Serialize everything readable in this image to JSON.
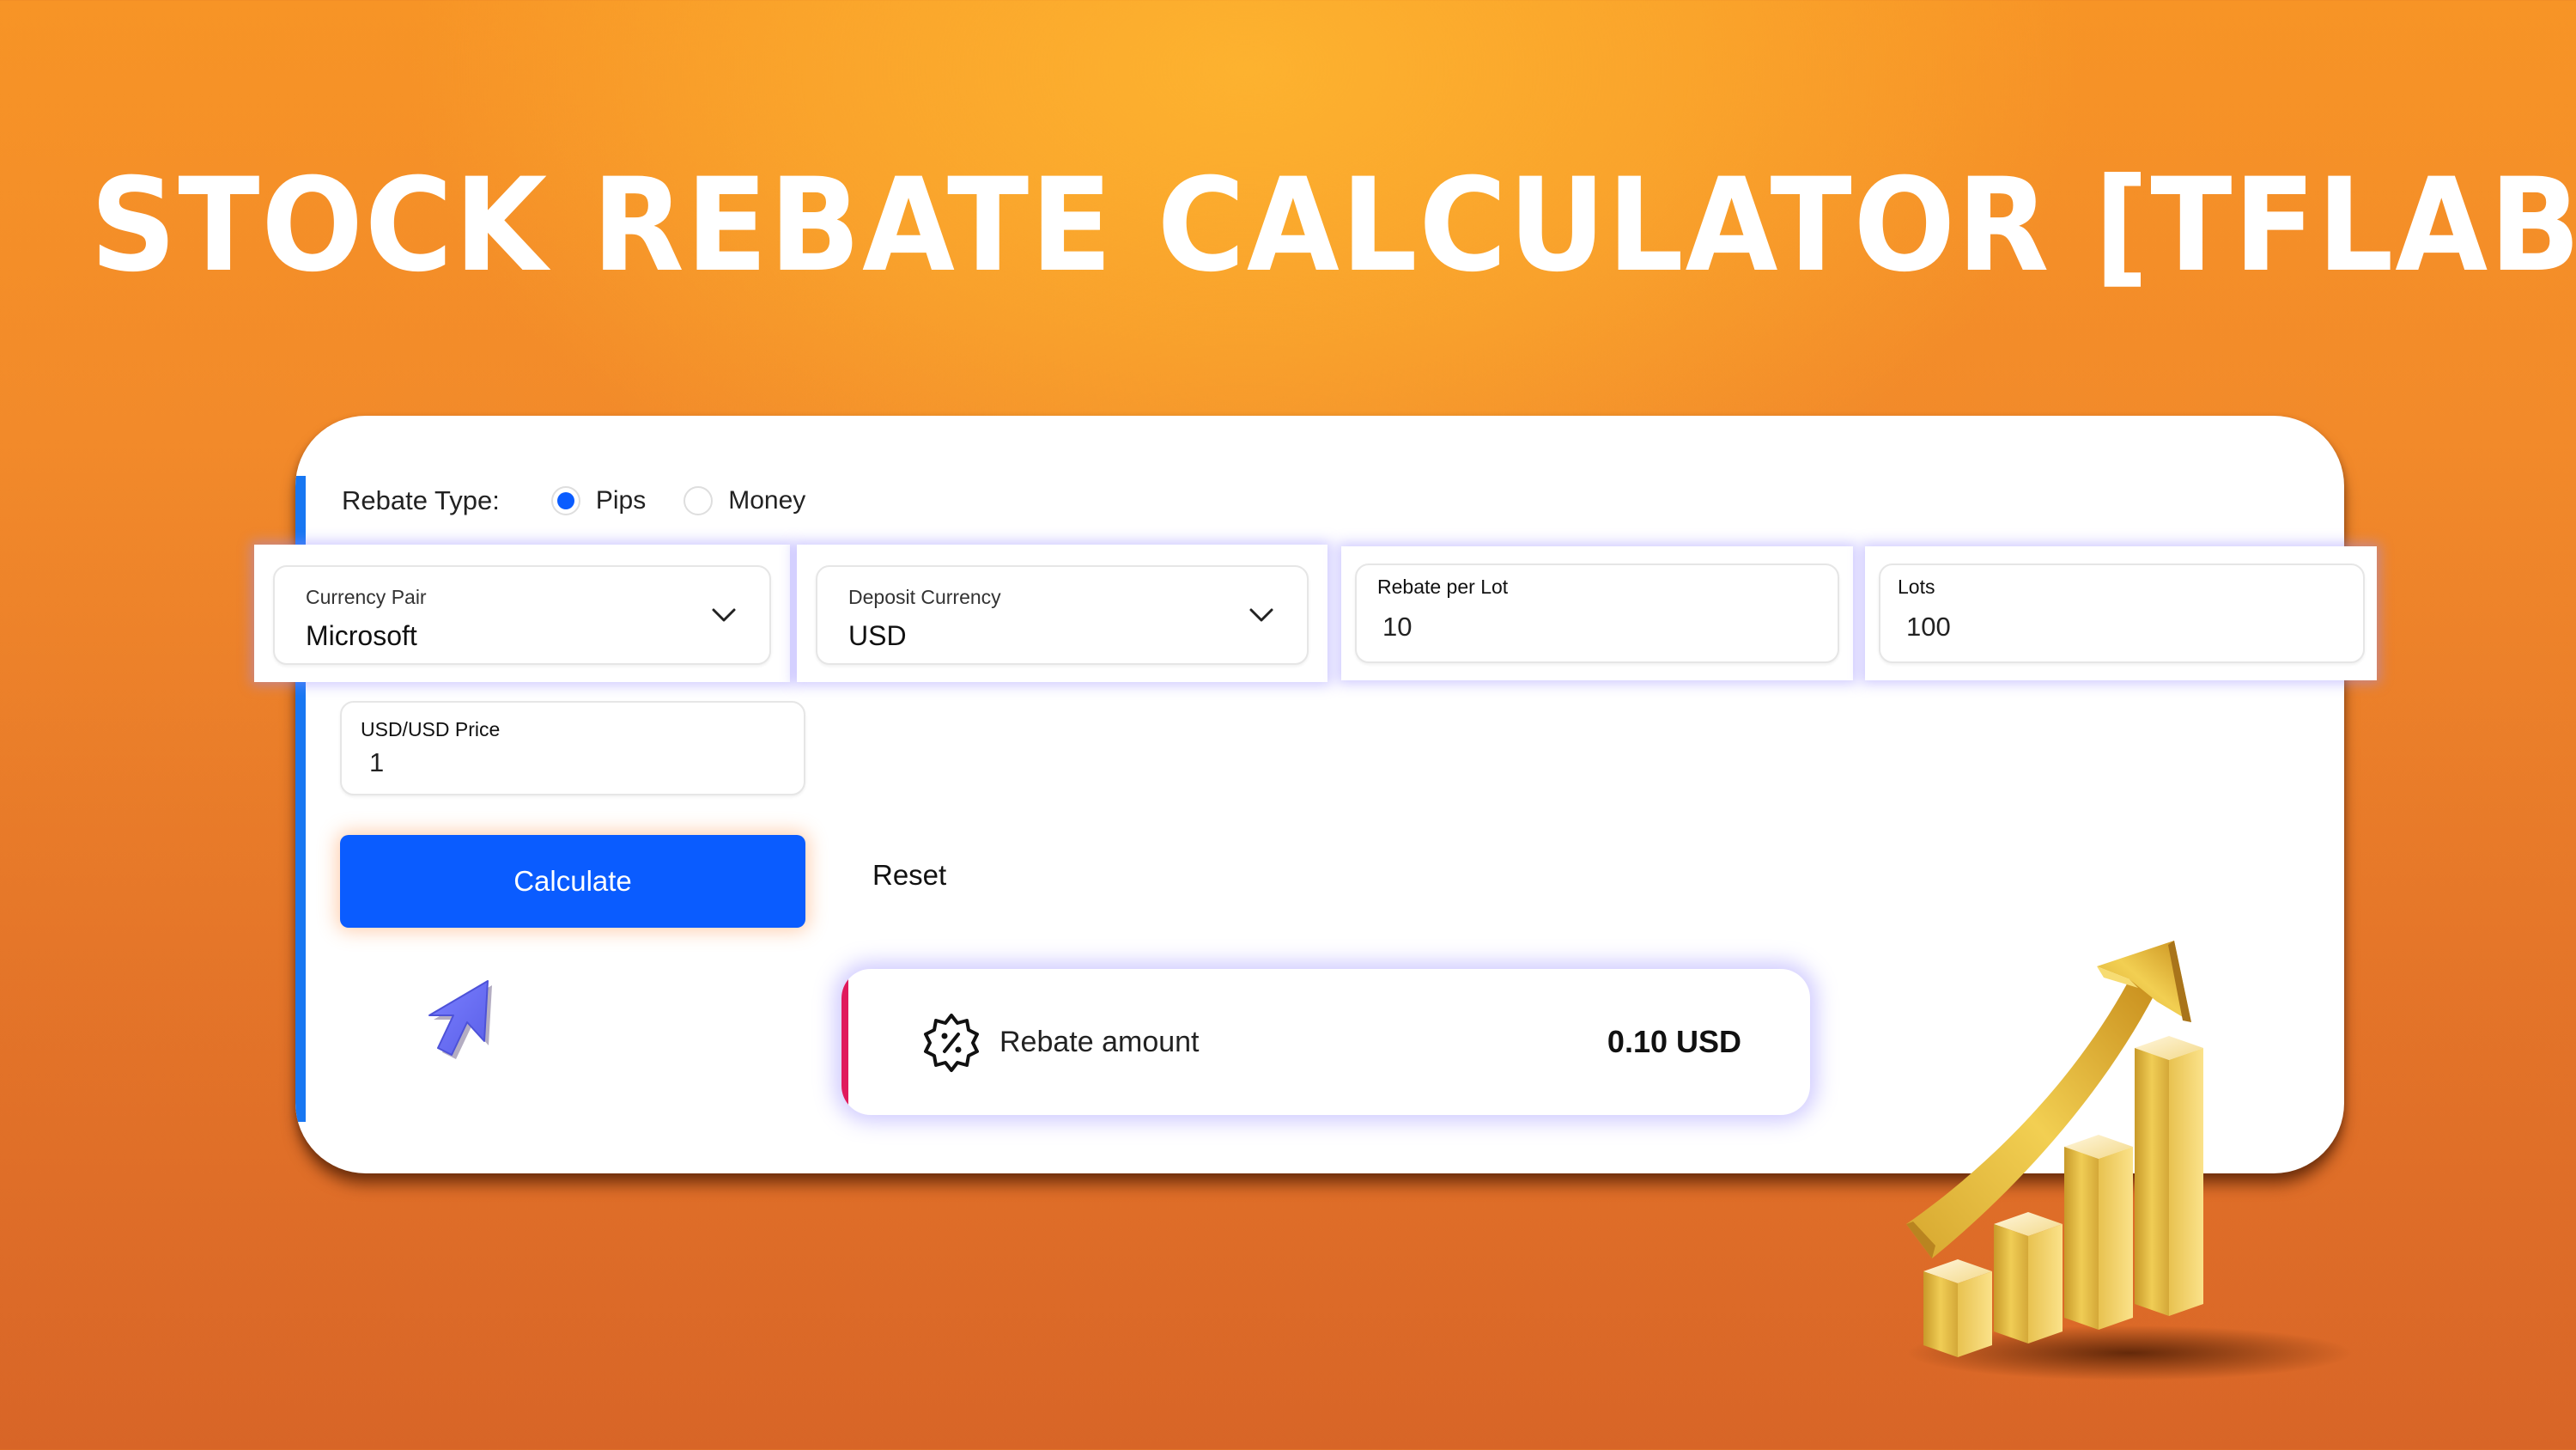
{
  "title": "STOCK REBATE CALCULATOR [TFLAB]",
  "rebate_type": {
    "label": "Rebate Type:",
    "options": [
      {
        "label": "Pips",
        "selected": true
      },
      {
        "label": "Money",
        "selected": false
      }
    ]
  },
  "fields": {
    "currency_pair": {
      "label": "Currency Pair",
      "value": "Microsoft",
      "type": "select"
    },
    "deposit_currency": {
      "label": "Deposit Currency",
      "value": "USD",
      "type": "select"
    },
    "rebate_per_lot": {
      "label": "Rebate per Lot",
      "value": "10",
      "type": "input"
    },
    "lots": {
      "label": "Lots",
      "value": "100",
      "type": "input"
    },
    "price": {
      "label": "USD/USD Price",
      "value": "1",
      "type": "input"
    }
  },
  "buttons": {
    "calculate": "Calculate",
    "reset": "Reset"
  },
  "result": {
    "label": "Rebate amount",
    "value": "0.10 USD",
    "icon": "percent-badge-icon"
  },
  "colors": {
    "primary": "#0a5cff",
    "accent_left": "#1877f2",
    "result_bar": "#e01a5c",
    "background_top": "#fdb22f",
    "background_bottom": "#d86527"
  },
  "decorations": {
    "cursor_icon": "pointer-cursor-icon",
    "growth_chart_icon": "gold-bar-chart-arrow-icon"
  }
}
